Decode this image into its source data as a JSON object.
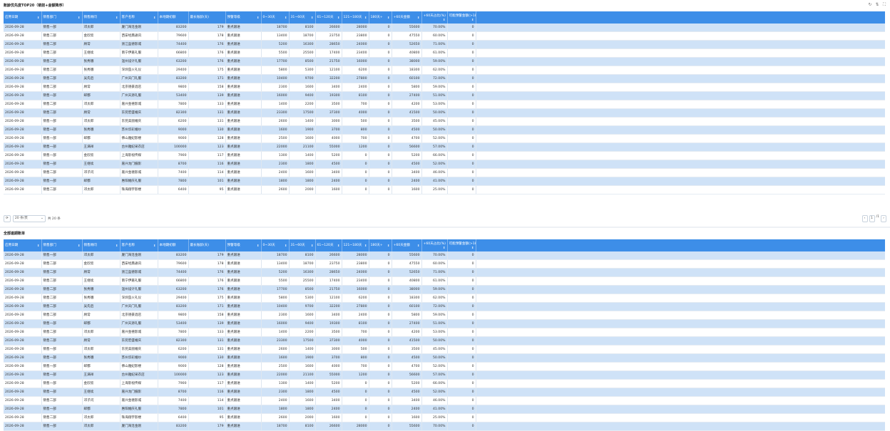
{
  "top_panel": {
    "title": "账龄优先度TOP20（销前+金额降序）",
    "toolbar": {
      "refresh_icon": "↻",
      "export_icon": "⇅",
      "fullscreen_icon": "⛶"
    }
  },
  "bottom_panel": {
    "title": "全部逾期账单"
  },
  "columns": [
    "应用日期",
    "销售部门",
    "销售顾问",
    "客户名称",
    "本地期初额",
    "最长账龄(天)",
    "预警等级",
    "0~30天",
    "31~60天",
    "61~120天",
    "121~180天",
    "180天+",
    "+60天金额",
    "+60天占比(%)",
    "可能预警金额(>180天)"
  ],
  "sort_icon": "⬍",
  "rows": [
    [
      "2026-09-28",
      "销售一部",
      "邓太郎",
      "厦门海沧金刚",
      "83200",
      "179",
      "重点跟进",
      "18700",
      "8100",
      "26600",
      "28000",
      "0",
      "55600",
      "70.00%",
      "0"
    ],
    [
      "2026-09-28",
      "销售二部",
      "金欣欣",
      "西安经典通讯",
      "79600",
      "178",
      "重点跟进",
      "13400",
      "18700",
      "23750",
      "23800",
      "0",
      "47550",
      "60.00%",
      "0"
    ],
    [
      "2026-09-28",
      "销售二部",
      "顾常",
      "浙江盈德影城",
      "74400",
      "176",
      "重点跟进",
      "5200",
      "16300",
      "28650",
      "24000",
      "0",
      "52650",
      "71.00%",
      "0"
    ],
    [
      "2026-09-28",
      "销售二部",
      "王继续",
      "南宁伊嘉礼服",
      "66800",
      "176",
      "重点跟进",
      "5500",
      "25500",
      "17400",
      "23400",
      "0",
      "40800",
      "61.00%",
      "0"
    ],
    [
      "2026-09-28",
      "销售二部",
      "张秀娥",
      "温州设计礼服",
      "63200",
      "176",
      "重点跟进",
      "17700",
      "8500",
      "21750",
      "16000",
      "0",
      "38000",
      "59.00%",
      "0"
    ],
    [
      "2026-09-28",
      "销售二部",
      "张秀娥",
      "深圳萤火礼仪",
      "29400",
      "175",
      "重点跟进",
      "5800",
      "5300",
      "12100",
      "6200",
      "0",
      "18300",
      "62.00%",
      "0"
    ],
    [
      "2026-09-28",
      "销售二部",
      "吴先后",
      "广州天门礼服",
      "83200",
      "171",
      "重点跟进",
      "10400",
      "9700",
      "32200",
      "27800",
      "0",
      "60100",
      "72.00%",
      "0"
    ],
    [
      "2026-09-28",
      "销售二部",
      "顾常",
      "北京德豪酒店",
      "9800",
      "158",
      "重点跟进",
      "2300",
      "1600",
      "3400",
      "2400",
      "0",
      "5800",
      "59.00%",
      "0"
    ],
    [
      "2026-09-28",
      "销售一部",
      "邮都",
      "广州天源礼服",
      "53400",
      "139",
      "重点跟进",
      "16000",
      "9400",
      "19300",
      "8100",
      "0",
      "27400",
      "51.00%",
      "0"
    ],
    [
      "2026-09-28",
      "销售二部",
      "邓太郎",
      "嘉兴金禧影城",
      "7800",
      "133",
      "重点跟进",
      "1400",
      "2200",
      "3500",
      "700",
      "0",
      "4200",
      "53.00%",
      "0"
    ],
    [
      "2026-09-28",
      "销售二部",
      "顾常",
      "东莞宏盛婚庆",
      "82300",
      "131",
      "重点跟进",
      "23300",
      "17500",
      "37300",
      "4000",
      "0",
      "41500",
      "50.00%",
      "0"
    ],
    [
      "2026-09-28",
      "销售一部",
      "邓太郎",
      "东莞美丽婚庆",
      "6200",
      "131",
      "重点跟进",
      "2600",
      "1400",
      "3000",
      "500",
      "0",
      "3500",
      "45.00%",
      "0"
    ],
    [
      "2026-09-28",
      "销售一部",
      "张秀娥",
      "苏州华彩婚纱",
      "9000",
      "130",
      "重点跟进",
      "1600",
      "1900",
      "3700",
      "800",
      "0",
      "4500",
      "50.00%",
      "0"
    ],
    [
      "2026-09-28",
      "销售一部",
      "邮都",
      "佛山雅妃影楼",
      "9000",
      "128",
      "重点跟进",
      "2500",
      "1600",
      "4000",
      "700",
      "0",
      "4700",
      "52.00%",
      "0"
    ],
    [
      "2026-09-28",
      "销售一部",
      "王满祥",
      "台州雅妃采衣店",
      "100000",
      "123",
      "重点跟进",
      "22000",
      "21100",
      "55000",
      "1200",
      "0",
      "56600",
      "57.00%",
      "0"
    ],
    [
      "2026-09-28",
      "销售一部",
      "金欣欣",
      "上海影视传媒",
      "7900",
      "117",
      "重点跟进",
      "1300",
      "1400",
      "5200",
      "0",
      "0",
      "5200",
      "66.00%",
      "0"
    ],
    [
      "2026-09-28",
      "销售一部",
      "王继续",
      "嘉兴龙门摄影",
      "8700",
      "116",
      "重点跟进",
      "2300",
      "1800",
      "4500",
      "0",
      "0",
      "4500",
      "52.00%",
      "0"
    ],
    [
      "2026-09-28",
      "销售二部",
      "邓子闪",
      "嘉兴金禧影城",
      "7400",
      "114",
      "重点跟进",
      "2400",
      "1600",
      "3400",
      "0",
      "0",
      "3400",
      "46.00%",
      "0"
    ],
    [
      "2026-09-28",
      "销售一部",
      "邮都",
      "惠阳婚庆礼服",
      "7800",
      "101",
      "重点跟进",
      "1800",
      "1800",
      "2400",
      "0",
      "0",
      "2400",
      "41.00%",
      "0"
    ],
    [
      "2026-09-28",
      "销售二部",
      "邓太郎",
      "珠海翔宇影楼",
      "6400",
      "95",
      "重点跟进",
      "2600",
      "2000",
      "1600",
      "0",
      "0",
      "1600",
      "25.00%",
      "0"
    ]
  ],
  "bottom_rows_visible": 21,
  "pager": {
    "page_size_label": "20 条/页",
    "total_label": "共 20 条",
    "current_page": "1",
    "page_count_label": "/1",
    "refresh_icon": "⟳",
    "chevron_icon": "⌄",
    "prev_icon": "‹",
    "next_icon": "›"
  }
}
